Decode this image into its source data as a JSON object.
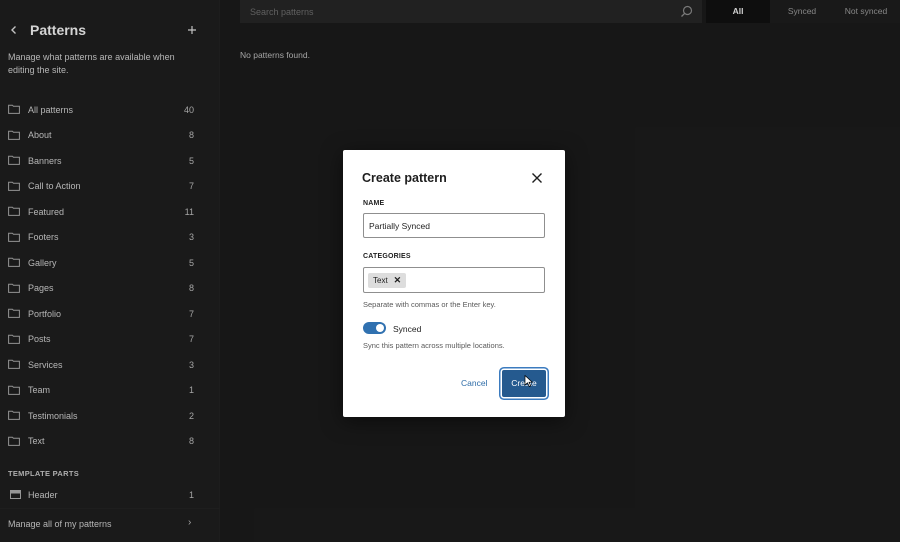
{
  "sidebar": {
    "back_icon": "chevron-left-icon",
    "title": "Patterns",
    "add_icon": "plus-icon",
    "description": "Manage what patterns are available when editing the site.",
    "items": [
      {
        "label": "All patterns",
        "count": "40"
      },
      {
        "label": "About",
        "count": "8"
      },
      {
        "label": "Banners",
        "count": "5"
      },
      {
        "label": "Call to Action",
        "count": "7"
      },
      {
        "label": "Featured",
        "count": "11"
      },
      {
        "label": "Footers",
        "count": "3"
      },
      {
        "label": "Gallery",
        "count": "5"
      },
      {
        "label": "Pages",
        "count": "8"
      },
      {
        "label": "Portfolio",
        "count": "7"
      },
      {
        "label": "Posts",
        "count": "7"
      },
      {
        "label": "Services",
        "count": "3"
      },
      {
        "label": "Team",
        "count": "1"
      },
      {
        "label": "Testimonials",
        "count": "2"
      },
      {
        "label": "Text",
        "count": "8"
      }
    ],
    "template_parts_label": "TEMPLATE PARTS",
    "template_parts": [
      {
        "label": "Header",
        "count": "1"
      }
    ],
    "footer_link": "Manage all of my patterns"
  },
  "main": {
    "search_placeholder": "Search patterns",
    "tabs": [
      {
        "label": "All",
        "active": true
      },
      {
        "label": "Synced",
        "active": false
      },
      {
        "label": "Not synced",
        "active": false
      }
    ],
    "empty_message": "No patterns found."
  },
  "modal": {
    "title": "Create pattern",
    "name_label": "NAME",
    "name_value": "Partially Synced",
    "categories_label": "CATEGORIES",
    "category_tokens": [
      "Text"
    ],
    "categories_help": "Separate with commas or the Enter key.",
    "synced_label": "Synced",
    "synced_on": true,
    "synced_help": "Sync this pattern across multiple locations.",
    "cancel_label": "Cancel",
    "create_label": "Create"
  },
  "colors": {
    "accent": "#3071b0",
    "primary_button": "#255a8f",
    "background": "#1b1b1b",
    "sidebar": "#1e1e1e"
  }
}
